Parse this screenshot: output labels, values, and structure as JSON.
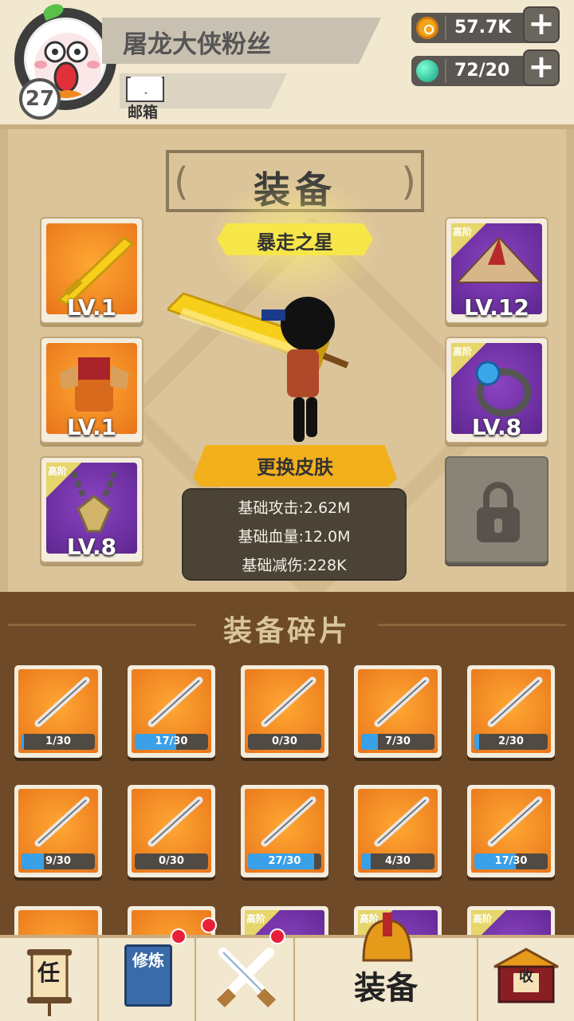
{
  "player": {
    "name": "屠龙大侠粉丝",
    "level": "27",
    "mail_label": "邮箱"
  },
  "resources": {
    "coins": "57.7K",
    "energy": "72/20",
    "plus": "+"
  },
  "equip": {
    "title": "装备",
    "skin_name": "暴走之星",
    "change_skin": "更换皮肤",
    "rank_label": "高阶",
    "slots": [
      {
        "name": "sword",
        "level": "LV.1",
        "rarity": "orange"
      },
      {
        "name": "armor",
        "level": "LV.1",
        "rarity": "orange"
      },
      {
        "name": "amulet",
        "level": "LV.8",
        "rarity": "purple"
      },
      {
        "name": "hat",
        "level": "LV.12",
        "rarity": "purple"
      },
      {
        "name": "ring",
        "level": "LV.8",
        "rarity": "purple"
      }
    ],
    "stats": {
      "attack": "基础攻击:2.62M",
      "hp": "基础血量:12.0M",
      "defense": "基础减伤:228K"
    }
  },
  "fragments": {
    "title": "装备碎片",
    "items": [
      {
        "name": "broadsword",
        "count": "1/30",
        "progress": 0.033
      },
      {
        "name": "staff",
        "count": "17/30",
        "progress": 0.567
      },
      {
        "name": "scissors",
        "count": "0/30",
        "progress": 0
      },
      {
        "name": "spear",
        "count": "7/30",
        "progress": 0.233
      },
      {
        "name": "mace",
        "count": "2/30",
        "progress": 0.067
      },
      {
        "name": "long-sword",
        "count": "9/30",
        "progress": 0.3
      },
      {
        "name": "helmet",
        "count": "0/30",
        "progress": 0
      },
      {
        "name": "straw-hat",
        "count": "27/30",
        "progress": 0.9
      },
      {
        "name": "key",
        "count": "4/30",
        "progress": 0.133
      },
      {
        "name": "armor",
        "count": "17/30",
        "progress": 0.567
      }
    ],
    "partial_rank_label": "高阶"
  },
  "nav": {
    "task": "任",
    "train": "修炼",
    "equip": "装备",
    "collect": "收"
  },
  "colors": {
    "orange_rarity": "#f08a1e",
    "purple_rarity": "#6f2fa6",
    "progress_blue": "#3aa0e8"
  }
}
